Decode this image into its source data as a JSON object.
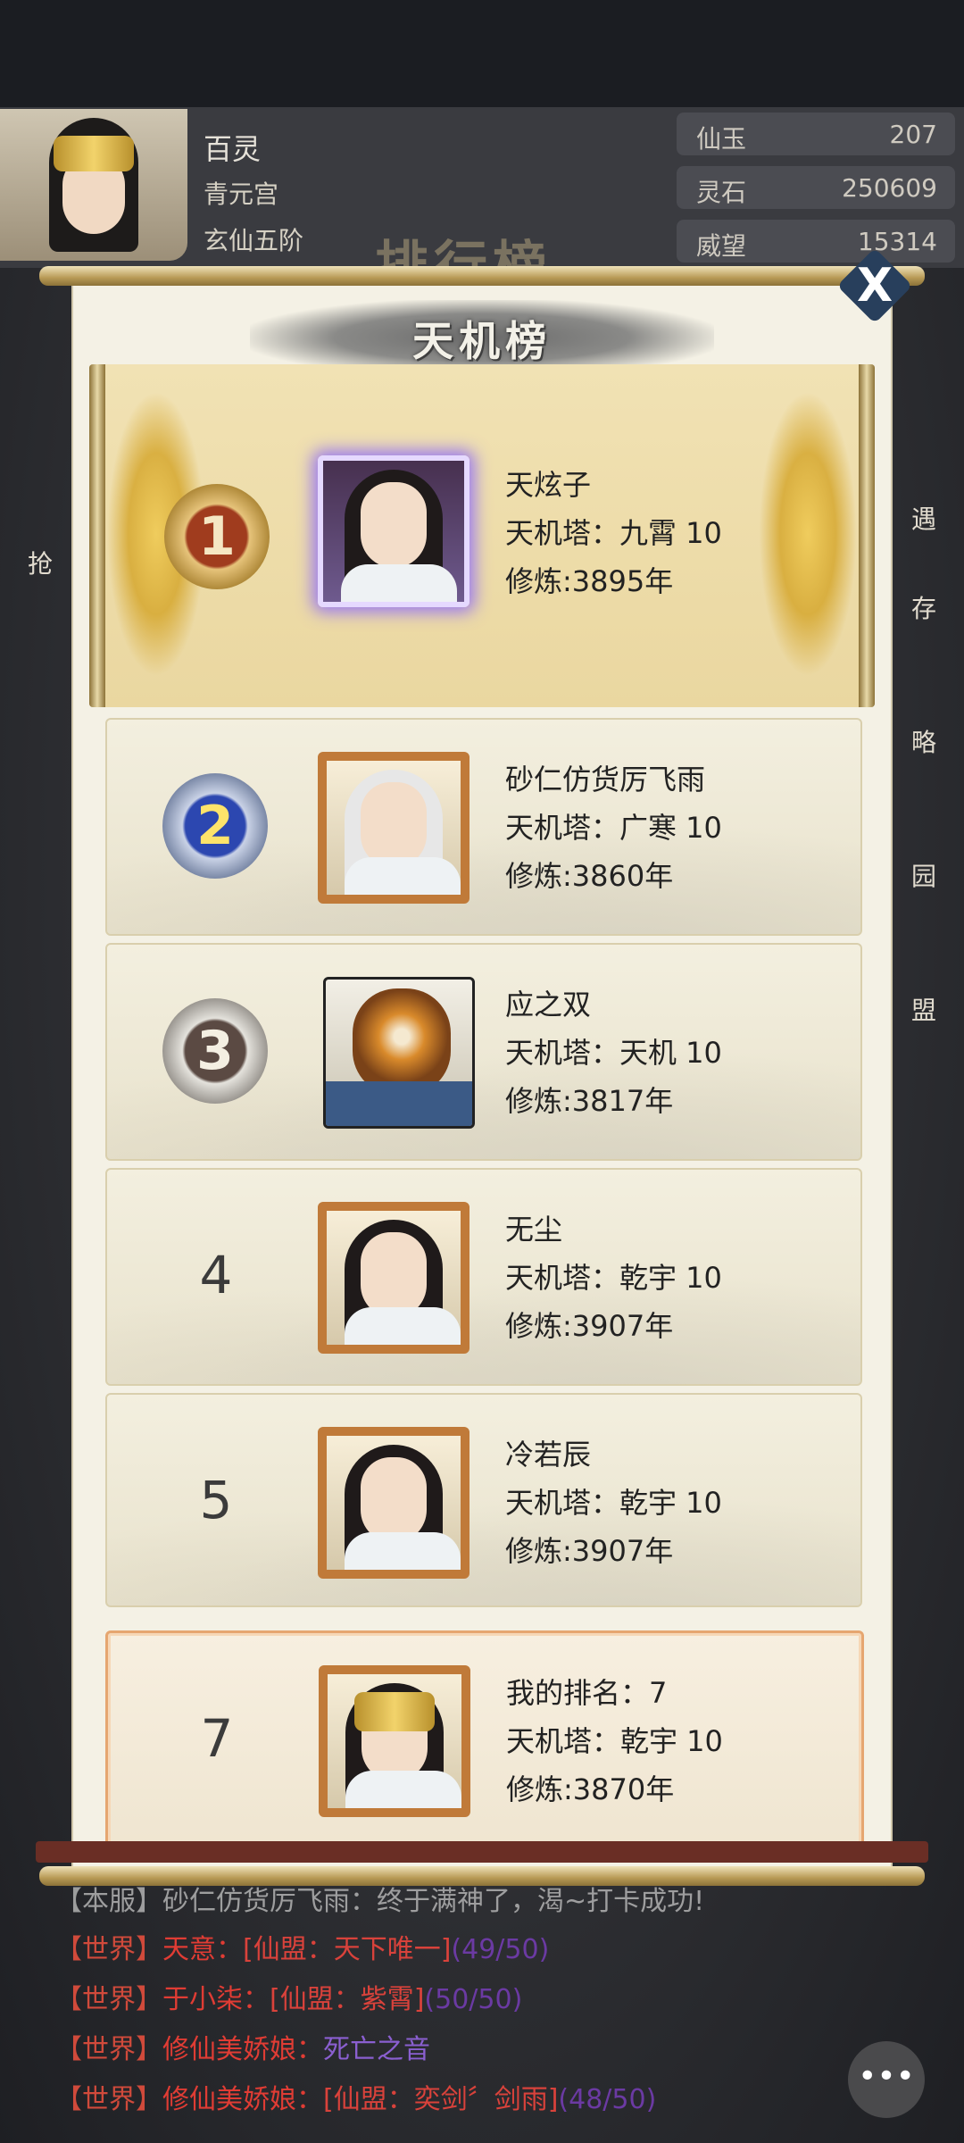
{
  "player": {
    "name": "百灵",
    "sect": "青元宫",
    "realm": "玄仙五阶"
  },
  "currencies": [
    {
      "label": "仙玉",
      "value": "207"
    },
    {
      "label": "灵石",
      "value": "250609"
    },
    {
      "label": "威望",
      "value": "15314"
    }
  ],
  "background_title": "排行榜",
  "modal": {
    "title": "天机榜",
    "close_label": "X"
  },
  "rankings": [
    {
      "rank": "1",
      "name": "天炫子",
      "tower": "天机塔：九霄 10",
      "cultivation": "修炼:3895年"
    },
    {
      "rank": "2",
      "name": "砂仁仿货厉飞雨",
      "tower": "天机塔：广寒 10",
      "cultivation": "修炼:3860年"
    },
    {
      "rank": "3",
      "name": "应之双",
      "tower": "天机塔：天机 10",
      "cultivation": "修炼:3817年"
    },
    {
      "rank": "4",
      "name": "无尘",
      "tower": "天机塔：乾宇 10",
      "cultivation": "修炼:3907年"
    },
    {
      "rank": "5",
      "name": "冷若辰",
      "tower": "天机塔：乾宇 10",
      "cultivation": "修炼:3907年"
    }
  ],
  "my_rank": {
    "rank": "7",
    "name": "我的排名：7",
    "tower": "天机塔：乾宇 10",
    "cultivation": "修炼:3870年"
  },
  "side_labels": [
    "遇",
    "存",
    "略",
    "园",
    "盟",
    "抢"
  ],
  "chat": [
    {
      "channel": "【本服】",
      "name": "砂仁仿货厉飞雨：",
      "guild": "",
      "content": "终于满神了，渴~打卡成功!",
      "progress": ""
    },
    {
      "channel": "【世界】",
      "name": "天意：",
      "guild": "[仙盟：天下唯一]",
      "content": "",
      "progress": "(49/50)"
    },
    {
      "channel": "【世界】",
      "name": "于小柒：",
      "guild": "[仙盟：紫霄]",
      "content": "",
      "progress": "(50/50)"
    },
    {
      "channel": "【世界】",
      "name": "修仙美娇娘：",
      "guild": "",
      "content": "死亡之音",
      "progress": ""
    },
    {
      "channel": "【世界】",
      "name": "修仙美娇娘：",
      "guild": "[仙盟：奕剑〞剑雨]",
      "content": "",
      "progress": "(48/50)"
    }
  ],
  "colors": {
    "modal_bg": "#f4f1e5",
    "gold_frame": "#c07a39",
    "my_rank_border": "#e6a670",
    "chat_channel": "#d04a3b",
    "chat_guild_purple": "#8a5fd0"
  },
  "icons": [
    "close-icon",
    "chat-bubble-icon",
    "rank-1-medal-icon",
    "rank-2-medal-icon",
    "rank-3-medal-icon"
  ]
}
